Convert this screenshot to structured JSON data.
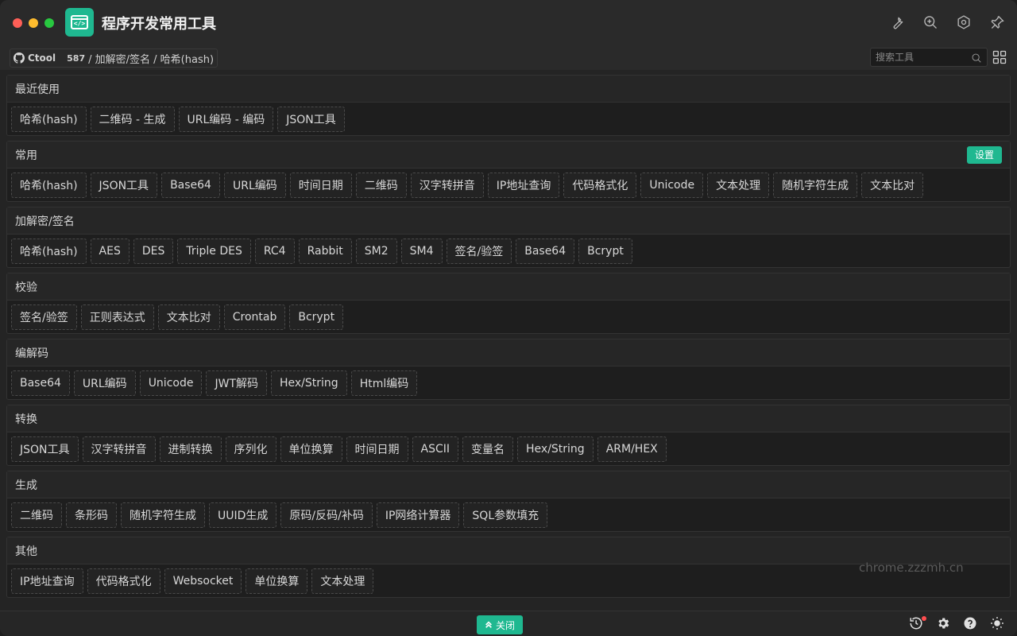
{
  "app": {
    "title": "程序开发常用工具",
    "accent": "#1fb890"
  },
  "titlebar_icons": [
    "wrench-icon",
    "zoom-in-icon",
    "hexagon-settings-icon",
    "pin-icon"
  ],
  "breadcrumb": {
    "brand": "Ctool",
    "count": "587",
    "path": "/ 加解密/签名 / 哈希(hash)"
  },
  "search": {
    "placeholder": "搜索工具"
  },
  "sections": [
    {
      "title": "最近使用",
      "tools": [
        "哈希(hash)",
        "二维码 - 生成",
        "URL编码 - 编码",
        "JSON工具"
      ]
    },
    {
      "title": "常用",
      "button": "设置",
      "tools": [
        "哈希(hash)",
        "JSON工具",
        "Base64",
        "URL编码",
        "时间日期",
        "二维码",
        "汉字转拼音",
        "IP地址查询",
        "代码格式化",
        "Unicode",
        "文本处理",
        "随机字符生成",
        "文本比对"
      ]
    },
    {
      "title": "加解密/签名",
      "tools": [
        "哈希(hash)",
        "AES",
        "DES",
        "Triple DES",
        "RC4",
        "Rabbit",
        "SM2",
        "SM4",
        "签名/验签",
        "Base64",
        "Bcrypt"
      ]
    },
    {
      "title": "校验",
      "tools": [
        "签名/验签",
        "正则表达式",
        "文本比对",
        "Crontab",
        "Bcrypt"
      ]
    },
    {
      "title": "编解码",
      "tools": [
        "Base64",
        "URL编码",
        "Unicode",
        "JWT解码",
        "Hex/String",
        "Html编码"
      ]
    },
    {
      "title": "转换",
      "tools": [
        "JSON工具",
        "汉字转拼音",
        "进制转换",
        "序列化",
        "单位换算",
        "时间日期",
        "ASCII",
        "变量名",
        "Hex/String",
        "ARM/HEX"
      ]
    },
    {
      "title": "生成",
      "tools": [
        "二维码",
        "条形码",
        "随机字符生成",
        "UUID生成",
        "原码/反码/补码",
        "IP网络计算器",
        "SQL参数填充"
      ]
    },
    {
      "title": "其他",
      "tools": [
        "IP地址查询",
        "代码格式化",
        "Websocket",
        "单位换算",
        "文本处理"
      ]
    }
  ],
  "footer": {
    "close_label": "关闭",
    "icons": [
      "history-icon",
      "settings-icon",
      "help-icon",
      "theme-sun-icon"
    ]
  },
  "watermark": "chrome.zzzmh.cn"
}
